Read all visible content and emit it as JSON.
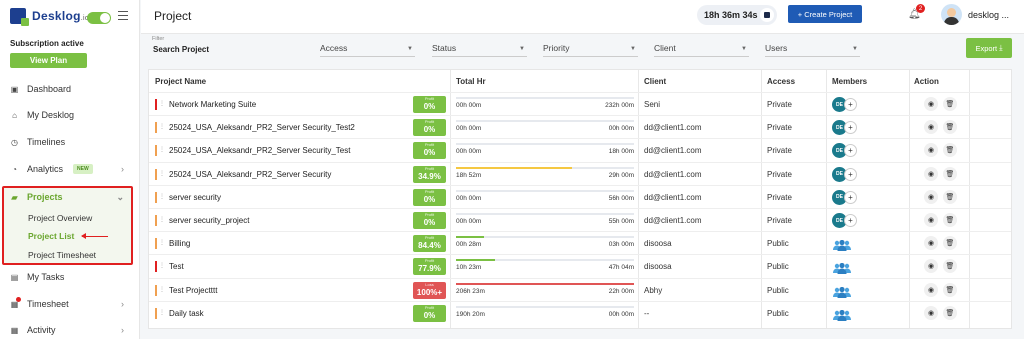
{
  "brand": {
    "name": "Desklog",
    "suffix": ".io"
  },
  "sidebar": {
    "subscription_status": "Subscription active",
    "view_plan_label": "View Plan",
    "items": [
      {
        "label": "Dashboard",
        "icon": "dashboard-icon"
      },
      {
        "label": "My Desklog",
        "icon": "home-icon"
      },
      {
        "label": "Timelines",
        "icon": "clock-icon"
      },
      {
        "label": "Analytics",
        "icon": "pie-icon",
        "badge": "NEW"
      },
      {
        "label": "Projects",
        "icon": "folder-icon"
      },
      {
        "label": "My Tasks",
        "icon": "tasks-icon"
      },
      {
        "label": "Timesheet",
        "icon": "timesheet-icon"
      },
      {
        "label": "Activity",
        "icon": "grid-icon"
      }
    ],
    "project_sub": [
      {
        "label": "Project Overview"
      },
      {
        "label": "Project List"
      },
      {
        "label": "Project Timesheet"
      }
    ]
  },
  "header": {
    "title": "Project",
    "timer": "18h 36m 34s",
    "create_label": "+ Create Project",
    "notification_count": "2",
    "user_name": "desklog ..."
  },
  "filters": {
    "label": "Filter",
    "search_placeholder": "Search Project",
    "dropdowns": [
      "Access",
      "Status",
      "Priority",
      "Client",
      "Users"
    ],
    "export_label": "Export"
  },
  "table": {
    "columns": [
      "Project Name",
      "Total Hr",
      "Client",
      "Access",
      "Members",
      "Action"
    ],
    "rows": [
      {
        "name": "Network Marketing Suite",
        "marker": "#e02020",
        "profit_label": "Profit",
        "profit": "0%",
        "profit_color": "#7bc043",
        "start": "00h 00m",
        "end": "232h 00m",
        "progress": 0,
        "bar_color": "#7bc043",
        "client": "Seni",
        "access": "Private",
        "member": "DE"
      },
      {
        "name": "25024_USA_Aleksandr_PR2_Server Security_Test2",
        "marker": "#f0a050",
        "profit_label": "Profit",
        "profit": "0%",
        "profit_color": "#7bc043",
        "start": "00h 00m",
        "end": "00h 00m",
        "progress": 0,
        "bar_color": "#7bc043",
        "client": "dd@client1.com",
        "access": "Private",
        "member": "DE"
      },
      {
        "name": "25024_USA_Aleksandr_PR2_Server Security_Test",
        "marker": "#f0a050",
        "profit_label": "Profit",
        "profit": "0%",
        "profit_color": "#7bc043",
        "start": "00h 00m",
        "end": "18h 00m",
        "progress": 0,
        "bar_color": "#7bc043",
        "client": "dd@client1.com",
        "access": "Private",
        "member": "DE"
      },
      {
        "name": "25024_USA_Aleksandr_PR2_Server Security",
        "marker": "#f0a050",
        "profit_label": "Profit",
        "profit": "34.9%",
        "profit_color": "#7bc043",
        "start": "18h 52m",
        "end": "29h 00m",
        "progress": 0.65,
        "bar_color": "#f5c842",
        "client": "dd@client1.com",
        "access": "Private",
        "member": "DE"
      },
      {
        "name": "server security",
        "marker": "#f0a050",
        "profit_label": "Profit",
        "profit": "0%",
        "profit_color": "#7bc043",
        "start": "00h 00m",
        "end": "56h 00m",
        "progress": 0,
        "bar_color": "#7bc043",
        "client": "dd@client1.com",
        "access": "Private",
        "member": "DE"
      },
      {
        "name": "server security_project",
        "marker": "#f0a050",
        "profit_label": "Profit",
        "profit": "0%",
        "profit_color": "#7bc043",
        "start": "00h 00m",
        "end": "55h 00m",
        "progress": 0,
        "bar_color": "#7bc043",
        "client": "dd@client1.com",
        "access": "Private",
        "member": "DE"
      },
      {
        "name": "Billing",
        "marker": "#f0a050",
        "profit_label": "Profit",
        "profit": "84.4%",
        "profit_color": "#7bc043",
        "start": "00h 28m",
        "end": "03h 00m",
        "progress": 0.16,
        "bar_color": "#7bc043",
        "client": "disoosa",
        "access": "Public",
        "member": ""
      },
      {
        "name": "Test",
        "marker": "#e02020",
        "profit_label": "Profit",
        "profit": "77.9%",
        "profit_color": "#7bc043",
        "start": "10h 23m",
        "end": "47h 04m",
        "progress": 0.22,
        "bar_color": "#7bc043",
        "client": "disoosa",
        "access": "Public",
        "member": ""
      },
      {
        "name": "Test Projectttt",
        "marker": "#f0a050",
        "profit_label": "Loss",
        "profit": "100%+",
        "profit_color": "#e05555",
        "start": "206h 23m",
        "end": "22h 00m",
        "progress": 1,
        "bar_color": "#e05555",
        "client": "Abhy",
        "access": "Public",
        "member": ""
      },
      {
        "name": "Daily task",
        "marker": "#f0a050",
        "profit_label": "Profit",
        "profit": "0%",
        "profit_color": "#7bc043",
        "start": "190h 20m",
        "end": "00h 00m",
        "progress": 0,
        "bar_color": "#7bc043",
        "client": "--",
        "access": "Public",
        "member": ""
      }
    ]
  }
}
